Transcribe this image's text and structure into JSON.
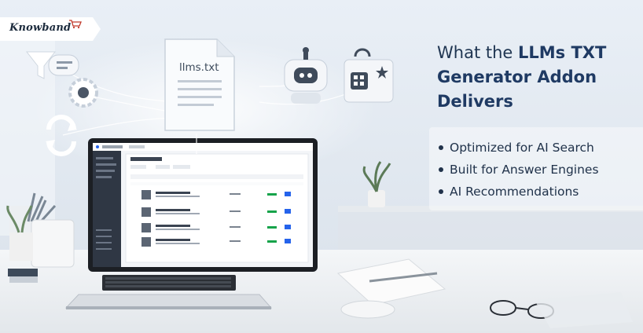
{
  "brand": {
    "logo_text": "nowband",
    "logo_initial": "K"
  },
  "headline": {
    "prefix": "What the ",
    "bold_line1": "LLMs TXT",
    "bold_line2": "Generator Addon",
    "bold_line3": "Delivers"
  },
  "bullets": [
    {
      "text": "Optimized for AI Search"
    },
    {
      "text": "Built for Answer Engines"
    },
    {
      "text": "AI Recommendations"
    }
  ],
  "document_icon": {
    "label": "llms.txt",
    "icon": "text-file-icon"
  },
  "icons": {
    "filter": "funnel-icon",
    "chat": "chat-bubble-icon",
    "settings": "gear-icon",
    "sync": "refresh-icon",
    "robot": "robot-icon",
    "shop": "shopping-bag-icon"
  },
  "colors": {
    "heading": "#1f3a63",
    "text": "#20324a",
    "logo_cart": "#c0392b",
    "screen_accent": "#2563eb"
  }
}
